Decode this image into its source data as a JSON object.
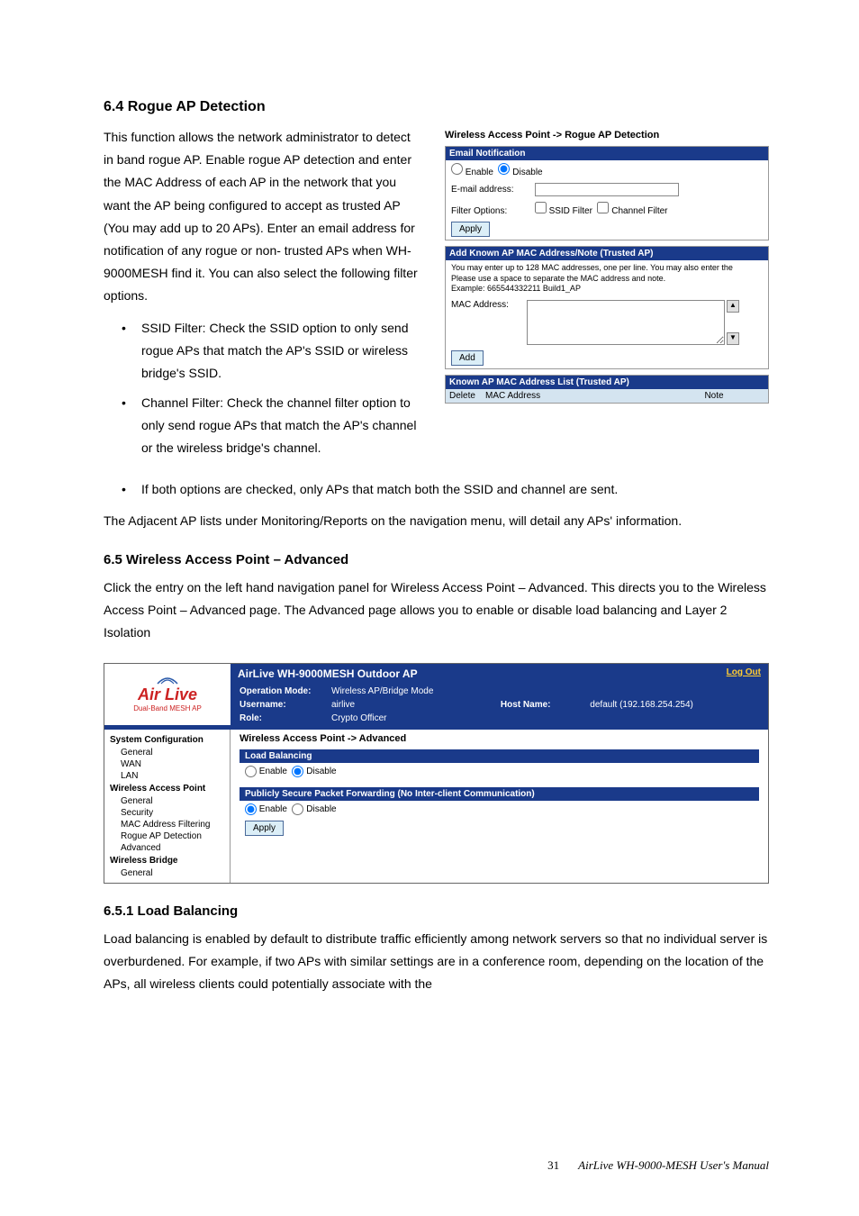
{
  "s1": {
    "h": "6.4 Rogue AP Detection",
    "p1": "This function allows the network administrator to detect in band rogue AP. Enable rogue AP detection and enter the MAC Address of each AP in the network that you want the AP being configured to accept as trusted AP (You may add up to 20 APs). Enter an email address for notification of any rogue or non- trusted APs when WH-9000MESH find it. You can also select the following filter options.",
    "b1": "SSID Filter: Check the SSID option to only send rogue APs that match the AP's SSID or wireless bridge's SSID.",
    "b2": "Channel Filter: Check the channel filter option to only send rogue APs that match the AP's channel or the wireless bridge's channel.",
    "b3": "If both options are checked, only APs that match both the SSID and channel are sent.",
    "p2": "The Adjacent AP lists under Monitoring/Reports on the navigation menu, will detail any APs' information."
  },
  "ui1": {
    "title": "Wireless Access Point -> Rogue AP Detection",
    "email_hdr": "Email Notification",
    "enable": "Enable",
    "disable": "Disable",
    "email_label": "E-mail address:",
    "filter_label": "Filter Options:",
    "ssid_filter": "SSID Filter",
    "chan_filter": "Channel Filter",
    "apply": "Apply",
    "add_hdr": "Add Known AP MAC Address/Note (Trusted AP)",
    "note1": "You may enter up to 128 MAC addresses, one per line. You may also enter the",
    "note2": "Please use a space to separate the MAC address and note.",
    "note3": "Example: 665544332211 Build1_AP",
    "mac_label": "MAC Address:",
    "add": "Add",
    "list_hdr": "Known AP MAC Address List (Trusted AP)",
    "col1": "Delete",
    "col2": "MAC Address",
    "col3": "Note"
  },
  "s2": {
    "h": "6.5 Wireless Access Point – Advanced",
    "p": "Click the entry on the left hand navigation panel for Wireless Access Point – Advanced. This directs you to the Wireless Access Point – Advanced page. The Advanced page allows you to enable or disable load balancing and Layer 2 Isolation"
  },
  "ui2": {
    "title": "AirLive WH-9000MESH Outdoor AP",
    "logout": "Log Out",
    "logo1": "Air Live",
    "logo2": "Dual-Band MESH AP",
    "op_l": "Operation Mode:",
    "op_v": "Wireless AP/Bridge Mode",
    "user_l": "Username:",
    "user_v": "airlive",
    "host_l": "Host Name:",
    "host_v": "default (192.168.254.254)",
    "role_l": "Role:",
    "role_v": "Crypto Officer",
    "bc": "Wireless Access Point -> Advanced",
    "lb_hdr": "Load Balancing",
    "sp_hdr": "Publicly Secure Packet Forwarding (No Inter-client Communication)",
    "enable": "Enable",
    "disable": "Disable",
    "apply": "Apply",
    "nav": {
      "g1": "System Configuration",
      "g1i": [
        "General",
        "WAN",
        "LAN"
      ],
      "g2": "Wireless Access Point",
      "g2i": [
        "General",
        "Security",
        "MAC Address Filtering",
        "Rogue AP Detection",
        "Advanced"
      ],
      "g3": "Wireless Bridge",
      "g3i": [
        "General"
      ]
    }
  },
  "s3": {
    "h": "6.5.1 Load Balancing",
    "p": "Load balancing is enabled by default to distribute traffic efficiently among network servers so that no individual server is overburdened. For example, if two APs with similar settings are in a conference room, depending on the location of the APs, all wireless clients could potentially associate with the"
  },
  "footer": {
    "page": "31",
    "title": "AirLive WH-9000-MESH User's Manual"
  }
}
